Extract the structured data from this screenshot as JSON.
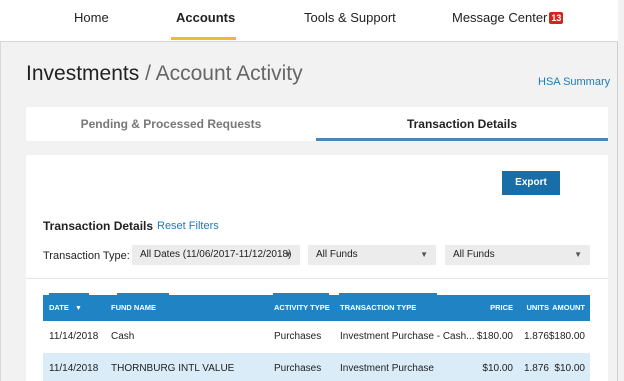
{
  "nav": {
    "home": "Home",
    "accounts": "Accounts",
    "tools": "Tools & Support",
    "messages": "Message Center",
    "message_count": "13"
  },
  "page": {
    "title": "Investments",
    "subtitle": "/ Account Activity",
    "hsa_link": "HSA Summary"
  },
  "tabs": [
    {
      "label": "Pending & Processed Requests",
      "active": false
    },
    {
      "label": "Transaction Details",
      "active": true
    }
  ],
  "panel": {
    "export_label": "Export",
    "heading": "Transaction Details",
    "reset_label": "Reset Filters",
    "filter_label": "Transaction Type:",
    "filters": [
      {
        "value": "All Dates (11/06/2017-11/12/2018)"
      },
      {
        "value": "All Funds"
      },
      {
        "value": "All Funds"
      }
    ]
  },
  "table": {
    "headers": [
      "DATE",
      "FUND NAME",
      "ACTIVITY TYPE",
      "TRANSACTION TYPE",
      "PRICE",
      "UNITS",
      "AMOUNT"
    ],
    "rows": [
      [
        "11/14/2018",
        "Cash",
        "Purchases",
        "Investment Purchase - Cash...",
        "$180.00",
        "1.876",
        "$180.00"
      ],
      [
        "11/14/2018",
        "THORNBURG INTL VALUE",
        "Purchases",
        "Investment Purchase",
        "$10.00",
        "1.876",
        "$10.00"
      ]
    ]
  },
  "colors": {
    "accent_blue": "#1f83c4",
    "nav_underline": "#f5b733",
    "badge_red": "#d3251d",
    "row_highlight": "#d9ecf8"
  }
}
